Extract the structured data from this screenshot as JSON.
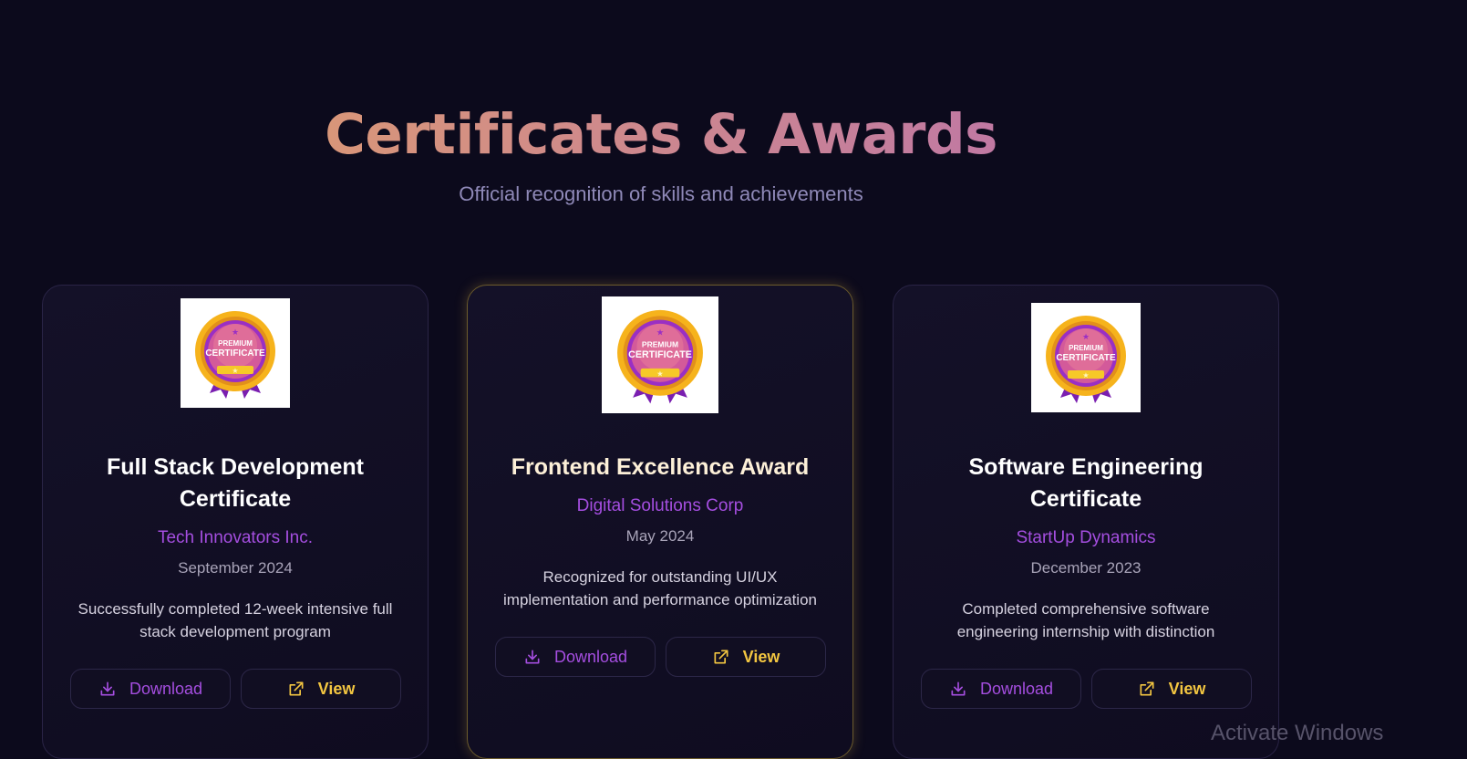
{
  "header": {
    "title": "Certificates & Awards",
    "subtitle": "Official recognition of skills and achievements"
  },
  "badge": {
    "top_text": "PREMIUM",
    "main_text": "CERTIFICATE"
  },
  "certificates": [
    {
      "title": "Full Stack Development Certificate",
      "issuer": "Tech Innovators Inc.",
      "date": "September 2024",
      "description": "Successfully completed 12-week intensive full stack development program",
      "download_label": "Download",
      "view_label": "View",
      "featured": false
    },
    {
      "title": "Frontend Excellence Award",
      "issuer": "Digital Solutions Corp",
      "date": "May 2024",
      "description": "Recognized for outstanding UI/UX implementation and performance optimization",
      "download_label": "Download",
      "view_label": "View",
      "featured": true
    },
    {
      "title": "Software Engineering Certificate",
      "issuer": "StartUp Dynamics",
      "date": "December 2023",
      "description": "Completed comprehensive software engineering internship with distinction",
      "download_label": "Download",
      "view_label": "View",
      "featured": false
    }
  ],
  "watermark": "Activate Windows",
  "colors": {
    "background": "#0c0a1c",
    "title_gradient_start": "#e4a463",
    "title_gradient_end": "#b56bb6",
    "issuer": "#a54ee0",
    "view_button": "#f3c641",
    "featured_border": "#6a5a2c"
  },
  "icons": {
    "download": "download-icon",
    "view": "external-link-icon",
    "badge": "certificate-badge-icon"
  }
}
